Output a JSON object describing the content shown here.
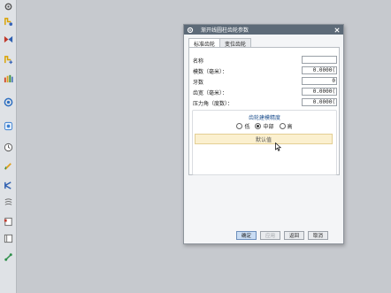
{
  "dialog": {
    "title": "渐开线圆柱齿轮参数",
    "tabs": [
      "标准齿轮",
      "变位齿轮"
    ],
    "fields": [
      {
        "label": "名称",
        "value": ""
      },
      {
        "label": "模数（毫米）：",
        "value": "0.0000("
      },
      {
        "label": "牙数",
        "value": "0"
      },
      {
        "label": "齿宽（毫米）：",
        "value": "0.0000("
      },
      {
        "label": "压力角（度数）：",
        "value": "0.0000("
      }
    ],
    "precision": {
      "title": "齿轮建模精度",
      "options": [
        "低",
        "中部",
        "高"
      ],
      "selected": "中部"
    },
    "default_button": "默认值",
    "buttons": [
      "确定",
      "应用",
      "返回",
      "取消"
    ]
  },
  "toolbar": {
    "icons": [
      "gear-icon",
      "gear-edit-icon",
      "gear-mesh-icon",
      "gear-move-icon",
      "gear-chart-icon",
      "gear-rotate-icon",
      "gear-info-icon",
      "clock-icon",
      "pencil-icon",
      "chevron-tool-icon",
      "spring-icon",
      "document-icon",
      "panel-icon",
      "connector-icon"
    ]
  },
  "colors": {
    "titlebar": "#5d6a78",
    "accent": "#1c4f8e",
    "default_button": "#fbf0cf"
  }
}
